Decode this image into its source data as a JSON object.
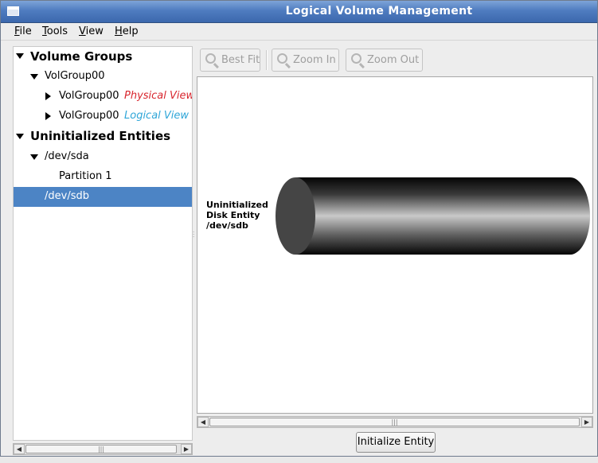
{
  "window": {
    "title": "Logical Volume Management"
  },
  "menu": [
    {
      "label": "File",
      "mnemonic": "F",
      "rest": "ile"
    },
    {
      "label": "Tools",
      "mnemonic": "T",
      "rest": "ools"
    },
    {
      "label": "View",
      "mnemonic": "V",
      "rest": "iew"
    },
    {
      "label": "Help",
      "mnemonic": "H",
      "rest": "elp"
    }
  ],
  "tree": {
    "volume_groups_header": "Volume Groups",
    "volgroup": "VolGroup00",
    "physical_child": {
      "name": "VolGroup00",
      "tag": "Physical View"
    },
    "logical_child": {
      "name": "VolGroup00",
      "tag": "Logical View"
    },
    "uninit_header": "Uninitialized Entities",
    "sda": "/dev/sda",
    "partition": "Partition 1",
    "sdb": "/dev/sdb",
    "selected": "/dev/sdb"
  },
  "toolbar": {
    "best_fit": "Best Fit",
    "zoom_in": "Zoom In",
    "zoom_out": "Zoom Out"
  },
  "canvas": {
    "label_line1": "Uninitialized",
    "label_line2": "Disk Entity",
    "label_line3": "/dev/sdb"
  },
  "actions": {
    "initialize": "Initialize Entity"
  },
  "colors": {
    "titlebar": "#4f7cc0",
    "selection": "#4c84c5",
    "physical_view": "#d8262e",
    "logical_view": "#2fa6d8"
  }
}
